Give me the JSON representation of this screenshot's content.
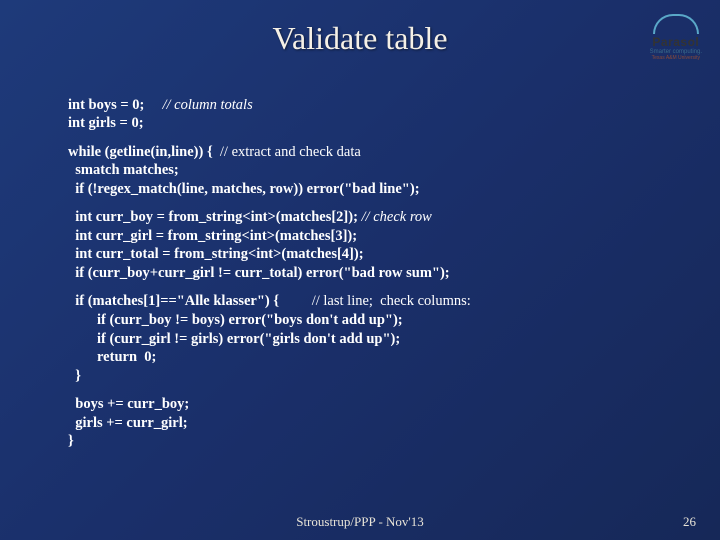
{
  "title": "Validate table",
  "logo": {
    "name": "Parasol",
    "tagline": "Smarter computing.",
    "sub": "Texas A&M University"
  },
  "code": {
    "b1": {
      "l1_code": "int boys = 0;",
      "l1_comment": "     // column totals",
      "l2_code": "int girls = 0;"
    },
    "b2": {
      "l1_code": "while (getline(in,line)) {  ",
      "l1_comment": "// extract and check data",
      "l2_code": "  smatch matches;",
      "l3_code": "  if (!regex_match(line, matches, row)) error(\"bad line\");"
    },
    "b3": {
      "l1_code": "  int curr_boy = from_string<int>(matches[2]); ",
      "l1_comment": "// check row",
      "l2_code": "  int curr_girl = from_string<int>(matches[3]);",
      "l3_code": "  int curr_total = from_string<int>(matches[4]);",
      "l4_code": "  if (curr_boy+curr_girl != curr_total) error(\"bad row sum\");"
    },
    "b4": {
      "l1_code": "  if (matches[1]==\"Alle klasser\") {         ",
      "l1_comment": "// last line;  check columns:",
      "l2_code": "        if (curr_boy != boys) error(\"boys don't add up\");",
      "l3_code": "        if (curr_girl != girls) error(\"girls don't add up\");",
      "l4_code": "        return  0;",
      "l5_code": "  }"
    },
    "b5": {
      "l1_code": "  boys += curr_boy;",
      "l2_code": "  girls += curr_girl;",
      "l3_code": "}"
    }
  },
  "footer": "Stroustrup/PPP - Nov'13",
  "page": "26"
}
